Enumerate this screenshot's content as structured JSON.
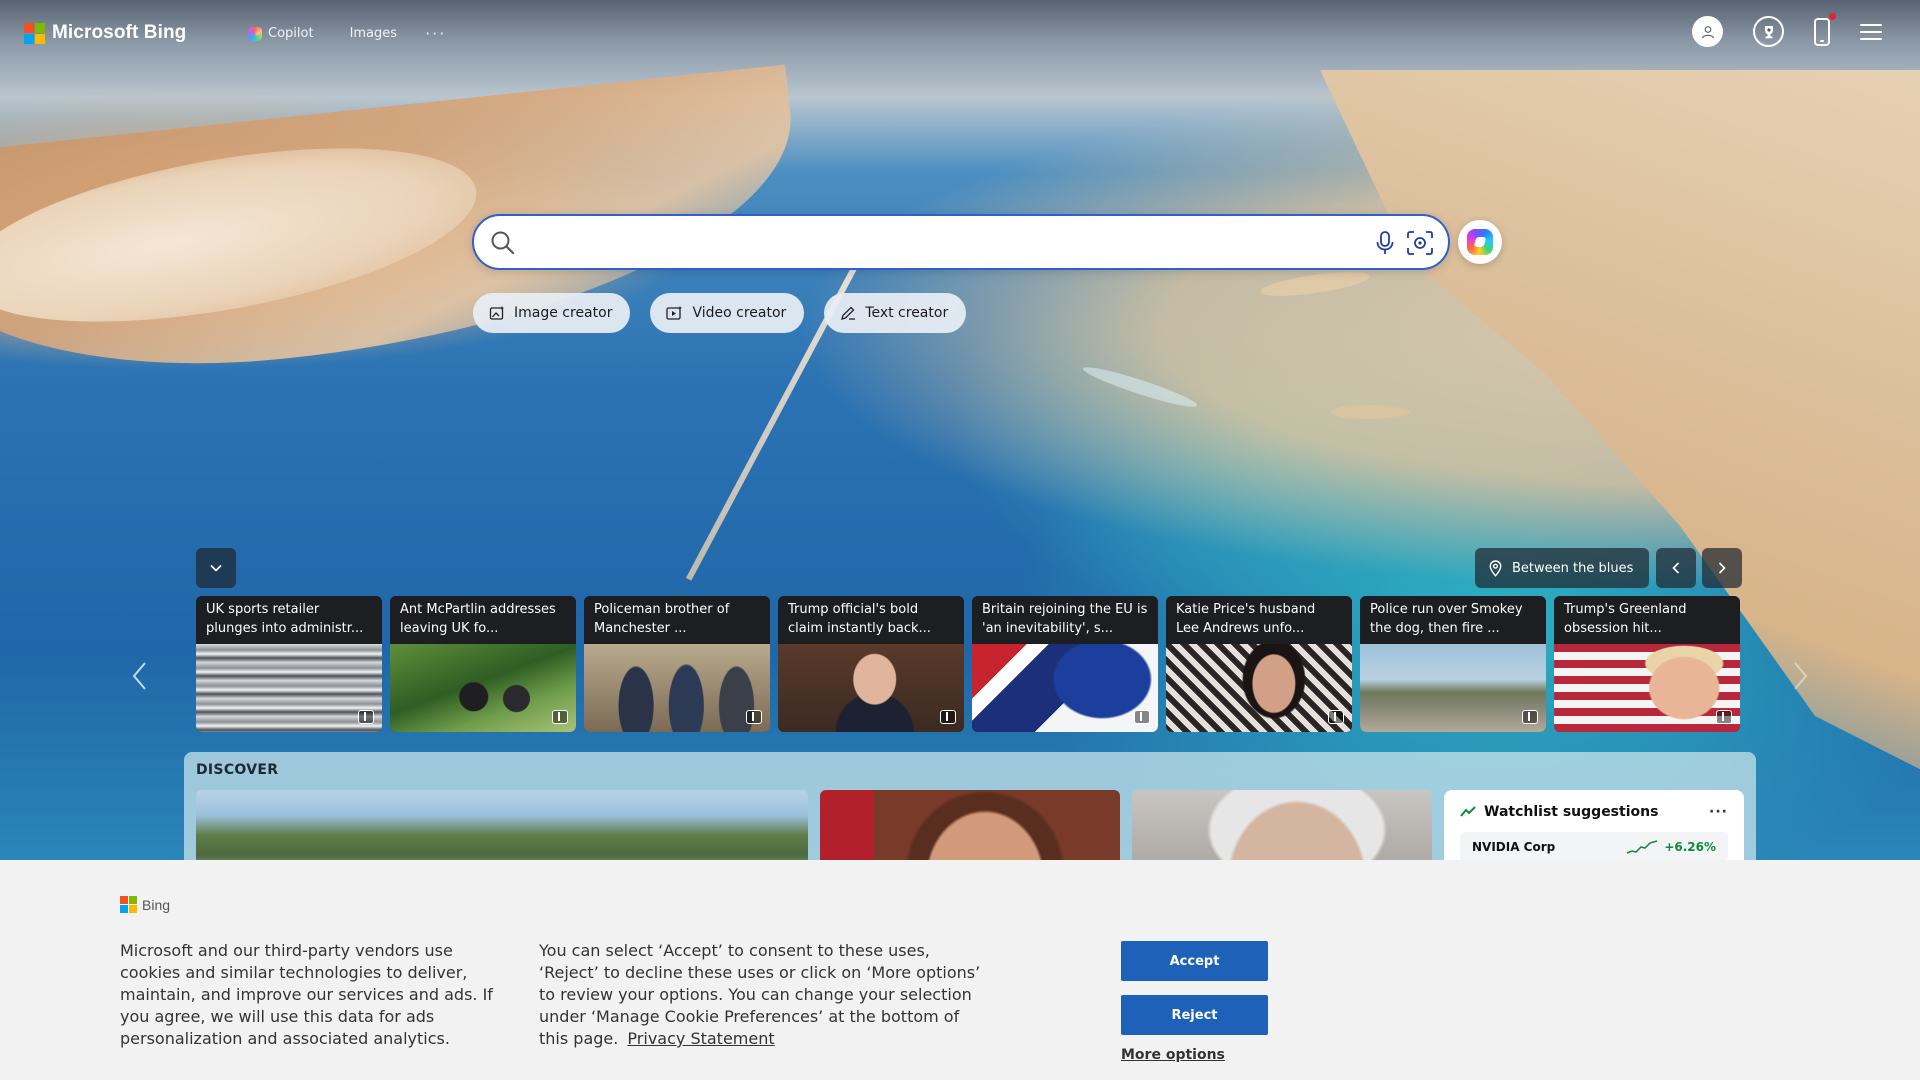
{
  "header": {
    "brand": "Microsoft Bing",
    "nav": [
      {
        "label": "Copilot",
        "icon": "copilot-icon"
      },
      {
        "label": "Images"
      }
    ],
    "more": "···"
  },
  "search": {
    "value": "",
    "placeholder": ""
  },
  "creators": [
    {
      "label": "Image creator",
      "icon": "image-creator-icon"
    },
    {
      "label": "Video creator",
      "icon": "video-creator-icon"
    },
    {
      "label": "Text creator",
      "icon": "text-creator-icon"
    }
  ],
  "location": {
    "label": "Between the blues"
  },
  "news": [
    {
      "headline": "UK sports retailer plunges into administr..."
    },
    {
      "headline": "Ant McPartlin addresses leaving UK fo..."
    },
    {
      "headline": "Policeman brother of Manchester ..."
    },
    {
      "headline": "Trump official's bold claim instantly back..."
    },
    {
      "headline": "Britain rejoining the EU is 'an inevitability', s..."
    },
    {
      "headline": "Katie Price's husband Lee Andrews unfo..."
    },
    {
      "headline": "Police run over Smokey the dog, then fire ..."
    },
    {
      "headline": "Trump's Greenland obsession hit..."
    }
  ],
  "discover": {
    "title": "DISCOVER",
    "watchlist": {
      "title": "Watchlist suggestions",
      "more": "···",
      "rows": [
        {
          "name": "NVIDIA Corp",
          "change": "+6.26%"
        }
      ]
    }
  },
  "cookie": {
    "brand": "Bing",
    "left_text": "Microsoft and our third-party vendors use cookies and similar technologies to deliver, maintain, and improve our services and ads. If you agree, we will use this data for ads personalization and associated analytics.",
    "right_text": "You can select ‘Accept’ to consent to these uses, ‘Reject’ to decline these uses or click on ‘More options’ to review your options. You can change your selection under ‘Manage Cookie Preferences’ at the bottom of this page.",
    "privacy_link": "Privacy Statement",
    "accept": "Accept",
    "reject": "Reject",
    "more_options": "More options"
  },
  "colors": {
    "ms_red": "#f25022",
    "ms_green": "#7fba00",
    "ms_blue": "#00a4ef",
    "ms_yellow": "#ffb900",
    "search_border": "#2f5fd0",
    "button_blue": "#1d62b8",
    "gain_green": "#0f8a3c"
  }
}
